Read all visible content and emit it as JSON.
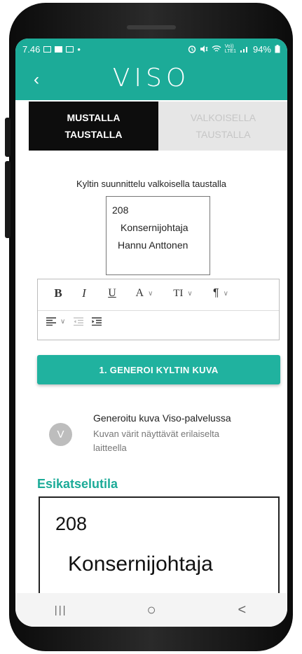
{
  "status_bar": {
    "time": "7.46",
    "dot": "•",
    "network": "Vo))\nLTE1",
    "battery": "94%"
  },
  "app": {
    "title": "VISO",
    "back": "‹"
  },
  "tabs": [
    {
      "line1": "MUSTALLA",
      "line2": "TAUSTALLA",
      "active": true
    },
    {
      "line1": "VALKOISELLA",
      "line2": "TAUSTALLA",
      "active": false
    }
  ],
  "design": {
    "label": "Kyltin suunnittelu valkoisella taustalla",
    "lines": [
      "208",
      "Konsernijohtaja",
      "Hannu Anttonen"
    ]
  },
  "toolbar": {
    "bold": "B",
    "italic": "I",
    "underline": "U",
    "font_color": "A",
    "font_size": "TI",
    "paragraph": "¶",
    "chevron": "∨"
  },
  "generate": {
    "button_label": "1. GENEROI KYLTIN KUVA",
    "avatar_letter": "V",
    "title": "Generoitu kuva Viso-palvelussa",
    "subtitle": "Kuvan värit näyttävät erilaiselta laitteella"
  },
  "preview": {
    "label": "Esikatselutila",
    "line1": "208",
    "line2": "Konsernijohtaja"
  },
  "nav": {
    "recents": "|||",
    "home": "○",
    "back": "<"
  },
  "colors": {
    "accent": "#1cab98",
    "button": "#20b29f",
    "active_tab": "#0d0d0d",
    "inactive_tab": "#e6e6e6"
  }
}
